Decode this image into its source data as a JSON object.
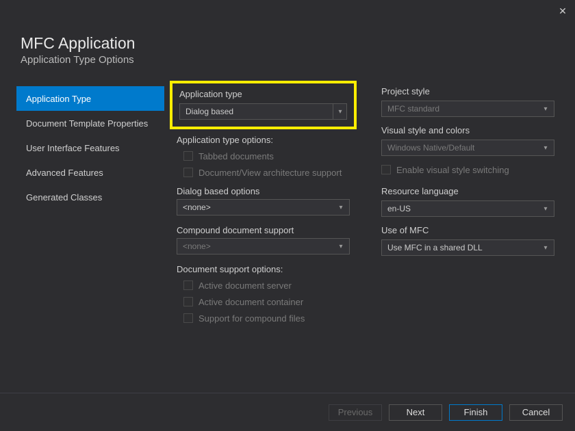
{
  "header": {
    "title": "MFC Application",
    "subtitle": "Application Type Options"
  },
  "sidebar": {
    "items": [
      {
        "label": "Application Type",
        "active": true
      },
      {
        "label": "Document Template Properties"
      },
      {
        "label": "User Interface Features"
      },
      {
        "label": "Advanced Features"
      },
      {
        "label": "Generated Classes"
      }
    ]
  },
  "left": {
    "app_type_label": "Application type",
    "app_type_value": "Dialog based",
    "app_type_options_label": "Application type options:",
    "tabbed_documents": "Tabbed documents",
    "doc_view_arch": "Document/View architecture support",
    "dialog_based_options_label": "Dialog based options",
    "dialog_based_value": "<none>",
    "compound_doc_label": "Compound document support",
    "compound_doc_value": "<none>",
    "doc_support_options_label": "Document support options:",
    "active_doc_server": "Active document server",
    "active_doc_container": "Active document container",
    "support_compound_files": "Support for compound files"
  },
  "right": {
    "project_style_label": "Project style",
    "project_style_value": "MFC standard",
    "visual_style_label": "Visual style and colors",
    "visual_style_value": "Windows Native/Default",
    "enable_visual_switching": "Enable visual style switching",
    "resource_language_label": "Resource language",
    "resource_language_value": "en-US",
    "use_mfc_label": "Use of MFC",
    "use_mfc_value": "Use MFC in a shared DLL"
  },
  "footer": {
    "previous": "Previous",
    "next": "Next",
    "finish": "Finish",
    "cancel": "Cancel"
  }
}
